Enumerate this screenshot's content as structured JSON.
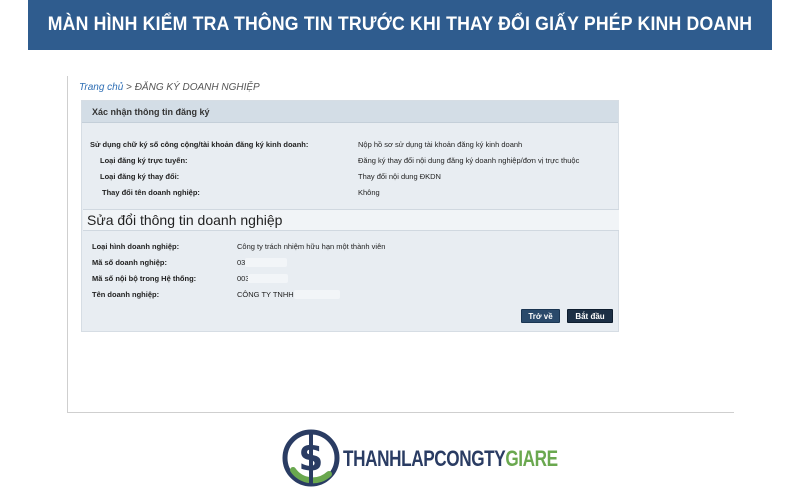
{
  "banner": {
    "title": "MÀN HÌNH KIỂM TRA THÔNG TIN TRƯỚC KHI THAY ĐỔI GIẤY PHÉP KINH DOANH"
  },
  "breadcrumb": {
    "home": "Trang chủ",
    "separator": " > ",
    "current": "ĐĂNG KÝ DOANH NGHIỆP"
  },
  "confirm_section": {
    "title": "Xác nhận thông tin đăng ký",
    "rows": [
      {
        "label": "Sử dụng chữ ký số công cộng/tài khoản đăng ký kinh doanh:",
        "value": "Nộp hồ sơ sử dụng tài khoản đăng ký kinh doanh"
      },
      {
        "label": "Loại đăng ký trực tuyến:",
        "value": "Đăng ký thay đổi nội dung đăng ký doanh nghiệp/đơn vị trực thuộc"
      },
      {
        "label": "Loại đăng ký thay đổi:",
        "value": "Thay đổi nội dung ĐKDN"
      },
      {
        "label": "Thay đổi tên doanh nghiệp:",
        "value": "Không"
      }
    ]
  },
  "edit_section": {
    "title": "Sửa đổi thông tin doanh nghiệp",
    "rows": [
      {
        "label": "Loại hình doanh nghiệp:",
        "value": "Công ty trách nhiệm hữu hạn một thành viên"
      },
      {
        "label": "Mã số doanh nghiệp:",
        "value": "03"
      },
      {
        "label": "Mã số nội bộ trong Hệ thống:",
        "value": "003"
      },
      {
        "label": "Tên doanh nghiệp:",
        "value": "CÔNG TY TNHH"
      }
    ]
  },
  "buttons": {
    "back": "Trở về",
    "start": "Bắt đầu"
  },
  "logo": {
    "text_dark": "THANHLAPCONGTY",
    "text_green": "GIARE"
  },
  "colors": {
    "banner": "#2f5c8e",
    "panel": "#e8edf2",
    "button": "#1c2f45",
    "brand_green": "#6aa84f",
    "brand_navy": "#2a3c63"
  }
}
